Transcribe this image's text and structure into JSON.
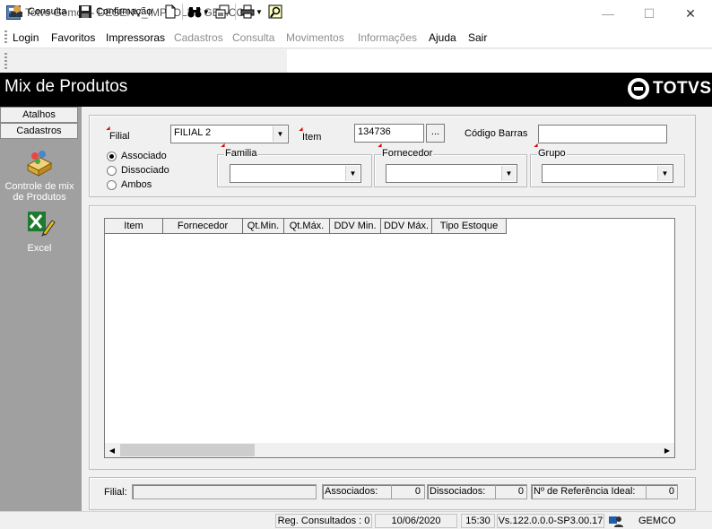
{
  "window": {
    "title": "Totvs Gemco - DESENV_IMPLOLD / GEMCO",
    "minimize": "—",
    "maximize": "☐",
    "close": "✕"
  },
  "menubar": {
    "items": [
      {
        "label": "Login",
        "enabled": true
      },
      {
        "label": "Favoritos",
        "enabled": true
      },
      {
        "label": "Impressoras",
        "enabled": true
      },
      {
        "label": "Cadastros",
        "enabled": false
      },
      {
        "label": "Consulta",
        "enabled": false
      },
      {
        "label": "Movimentos",
        "enabled": false
      },
      {
        "label": "Informações",
        "enabled": false
      },
      {
        "label": "Ajuda",
        "enabled": true
      },
      {
        "label": "Sair",
        "enabled": true
      }
    ]
  },
  "toolbar": {
    "consulta_label": "Consulta",
    "confirmacao_label": "Confirmação"
  },
  "header": {
    "page_title": "Mix de Produtos",
    "brand": "TOTVS"
  },
  "sidebar": {
    "tabs": [
      "Atalhos",
      "Cadastros"
    ],
    "items": [
      {
        "label_line1": "Controle de mix",
        "label_line2": "de Produtos",
        "icon": "people-box-icon"
      },
      {
        "label_line1": "Excel",
        "label_line2": "",
        "icon": "excel-icon"
      }
    ]
  },
  "form": {
    "filial_label": "Filial",
    "filial_value": "FILIAL 2",
    "item_label": "Item",
    "item_value": "134736",
    "lookup_button": "...",
    "codigo_barras_label": "Código Barras",
    "codigo_barras_value": "",
    "radio_options": [
      {
        "label": "Associado",
        "selected": true
      },
      {
        "label": "Dissociado",
        "selected": false
      },
      {
        "label": "Ambos",
        "selected": false
      }
    ],
    "familia_label": "Familia",
    "familia_value": "",
    "fornecedor_label": "Fornecedor",
    "fornecedor_value": "",
    "grupo_label": "Grupo",
    "grupo_value": ""
  },
  "grid": {
    "columns": [
      "Item",
      "Fornecedor",
      "Qt.Min.",
      "Qt.Máx.",
      "DDV Min.",
      "DDV Máx.",
      "Tipo Estoque"
    ],
    "rows": []
  },
  "footer": {
    "filial_label": "Filial:",
    "filial_value": "",
    "associados_label": "Associados:",
    "associados_value": "0",
    "dissociados_label": "Dissociados:",
    "dissociados_value": "0",
    "referencia_label": "Nº de Referência Ideal:",
    "referencia_value": "0"
  },
  "statusbar": {
    "reg_consultados": "Reg. Consultados : 0",
    "date": "10/06/2020",
    "time": "15:30",
    "version": "Vs.122.0.0.0-SP3.00.17",
    "environment": "GEMCO"
  },
  "colors": {
    "header_bg": "#000000",
    "sidebar_bg": "#a0a0a0",
    "required_marker": "#dd0000"
  }
}
